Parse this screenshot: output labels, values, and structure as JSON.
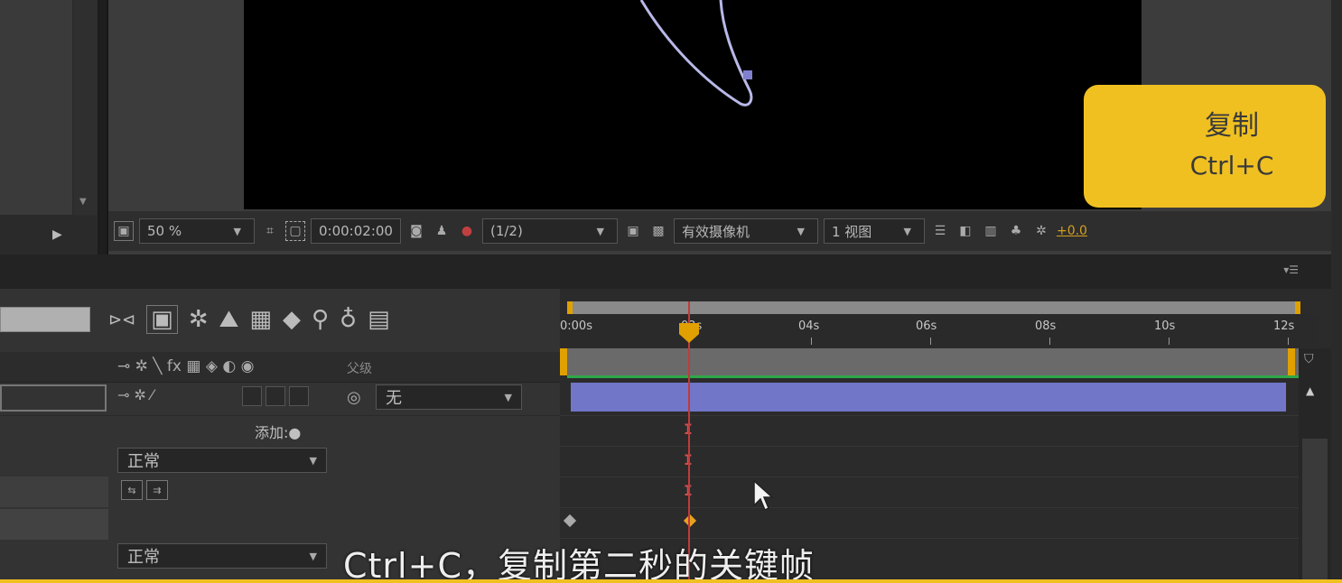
{
  "badge": {
    "title": "复制",
    "shortcut": "Ctrl+C"
  },
  "comp_toolbar": {
    "zoom": "50 %",
    "timecode": "0:00:02:00",
    "resolution": "(1/2)",
    "camera": "有效摄像机",
    "views": "1 视图",
    "exposure": "+0.0"
  },
  "timeline": {
    "parent_header": "父级",
    "parent_value": "无",
    "add_label": "添加:",
    "blend_mode_1": "正常",
    "blend_mode_2": "正常",
    "ruler_ticks": [
      "0:00s",
      "02s",
      "04s",
      "06s",
      "08s",
      "10s",
      "12s"
    ],
    "playhead_time": "02s"
  },
  "subtitle": "Ctrl+C，复制第二秒的关键帧",
  "colors": {
    "badge": "#f0c021",
    "layer_bar": "#7176c8",
    "playhead": "#c23a3a",
    "work_area_marker": "#e0a000"
  }
}
